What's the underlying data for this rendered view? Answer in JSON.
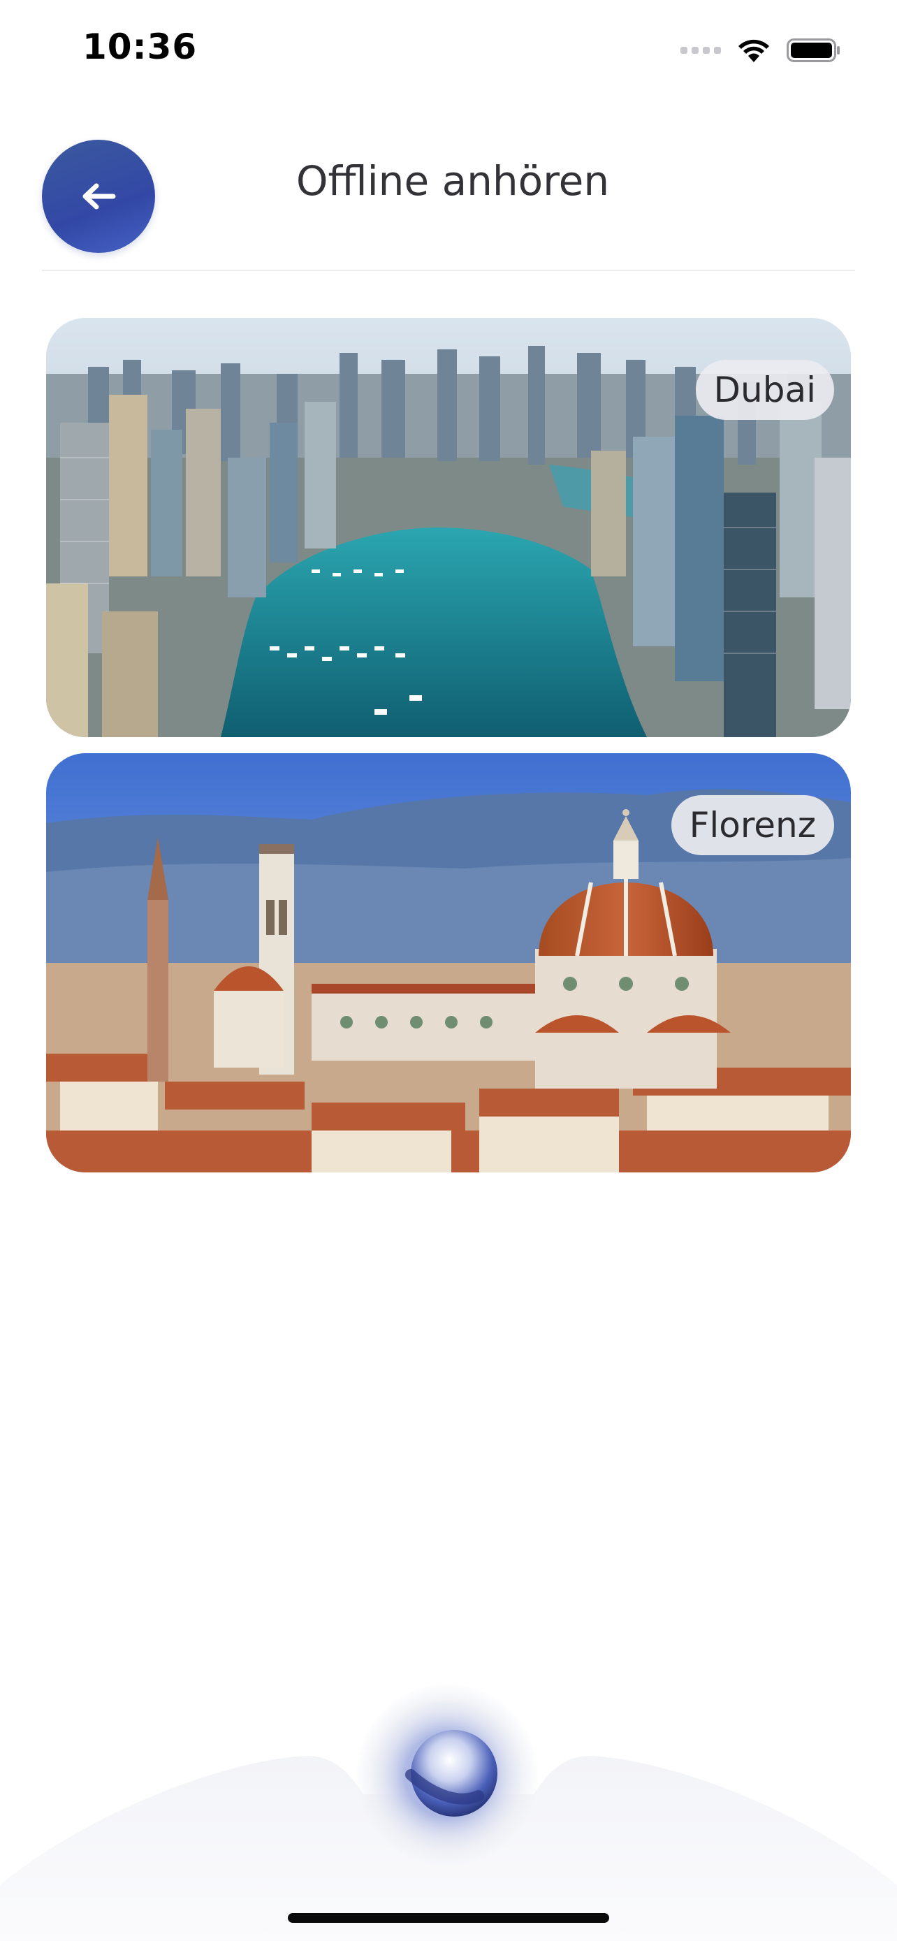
{
  "status_bar": {
    "time": "10:36"
  },
  "header": {
    "title": "Offline anhören",
    "back_icon": "arrow-left-icon"
  },
  "cities": [
    {
      "name": "Dubai"
    },
    {
      "name": "Florenz"
    }
  ],
  "assistant": {
    "icon": "assistant-orb-icon"
  },
  "colors": {
    "accent": "#3a4fa8",
    "title_text": "#333337",
    "badge_bg": "#ececf0"
  }
}
